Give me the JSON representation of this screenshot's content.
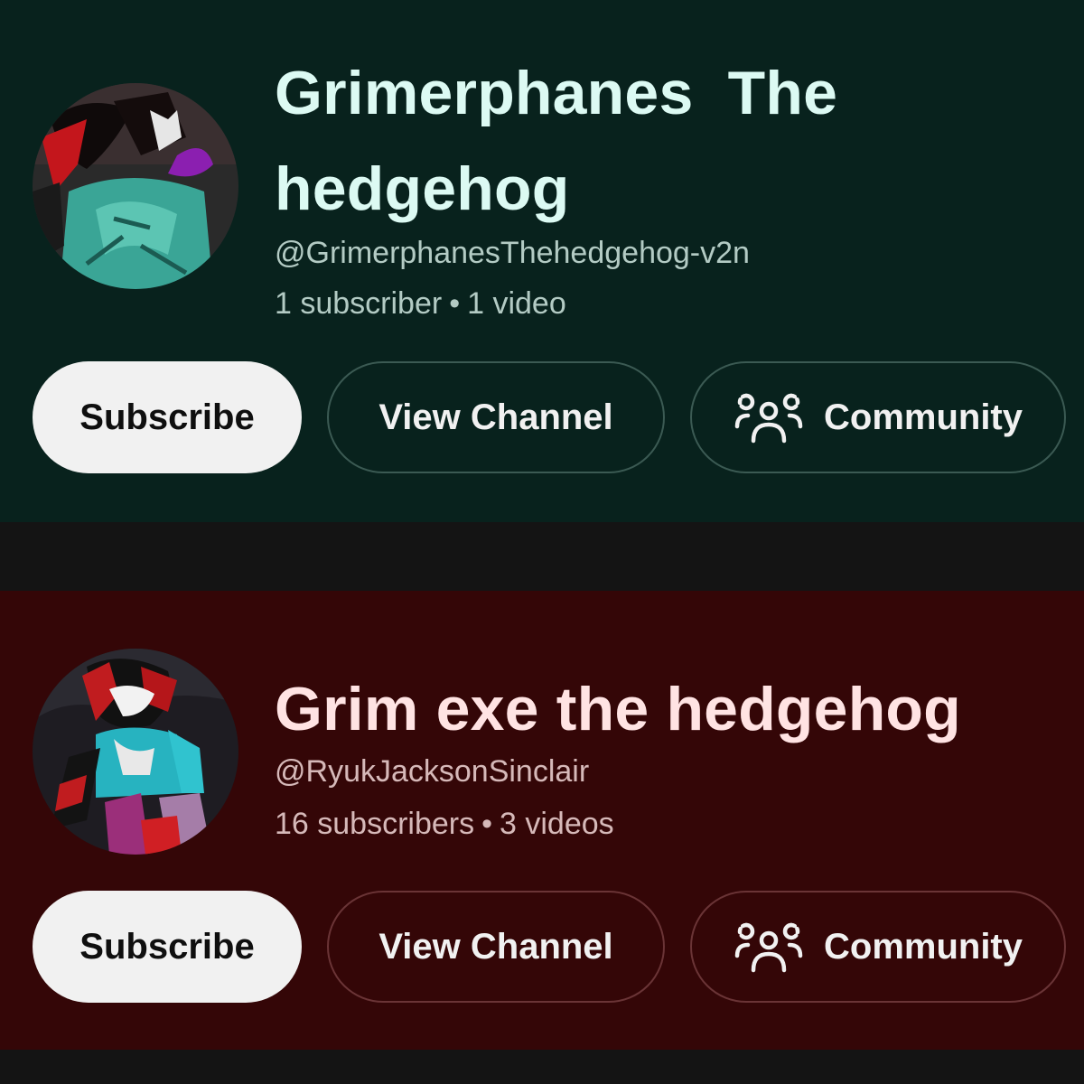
{
  "channels": [
    {
      "title": "Grimerphanes  The hedgehog",
      "handle": "@GrimerphanesThehedgehog-v2n",
      "subscribers": "1 subscriber",
      "separator": "•",
      "videos": "1 video",
      "background": "#08221d",
      "subscribe_label": "Subscribe",
      "view_channel_label": "View Channel",
      "community_label": "Community",
      "community_icon": "community-icon"
    },
    {
      "title": "Grim exe the hedgehog",
      "handle": "@RyukJacksonSinclair",
      "subscribers": "16 subscribers",
      "separator": "•",
      "videos": "3 videos",
      "background": "#340607",
      "subscribe_label": "Subscribe",
      "view_channel_label": "View Channel",
      "community_label": "Community",
      "community_icon": "community-icon"
    }
  ]
}
